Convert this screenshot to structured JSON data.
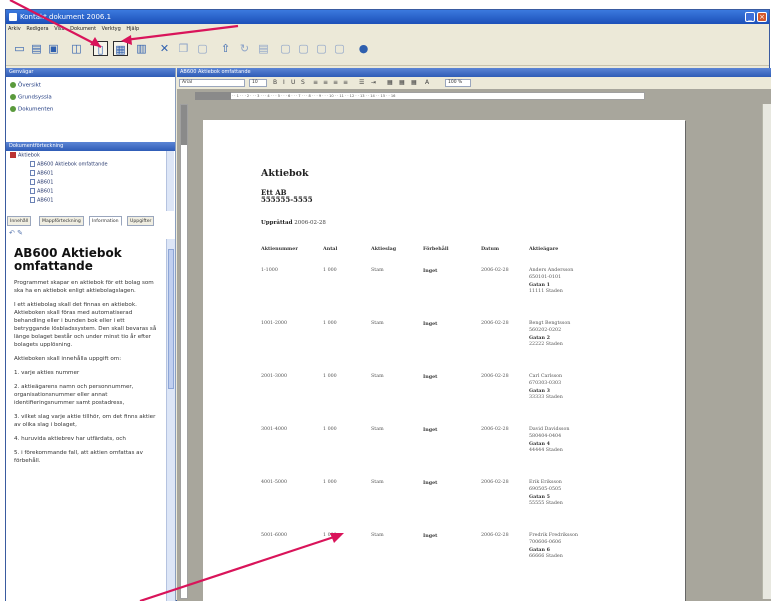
{
  "window": {
    "title": "Kontakt dokument 2006.1"
  },
  "menu": [
    "Arkiv",
    "Redigera",
    "Visa",
    "Dokument",
    "Verktyg",
    "Hjälp"
  ],
  "toolbar": {
    "icons": [
      "new-doc-icon",
      "open-icon",
      "save-icon",
      "print-preview-icon",
      "copy-doc-icon",
      "layout-icon",
      "columns-icon",
      "cut-icon",
      "copy-icon",
      "paste-icon",
      "upload-icon",
      "refresh-icon",
      "document-icon",
      "frame-icon",
      "frame-icon",
      "frame-icon",
      "frame-icon",
      "help-icon"
    ]
  },
  "left": {
    "header1": "Genvägar",
    "links": [
      "Översikt",
      "Grundsyssla",
      "Dokumenten"
    ],
    "header2": "Dokumentförteckning",
    "tree": {
      "root": "Aktiebok",
      "items": [
        "AB600 Aktiebok omfattande",
        "AB601",
        "AB601",
        "AB601",
        "AB601"
      ]
    },
    "tabs": [
      "Innehåll",
      "Mappförteckning",
      "Information",
      "Uppgifter"
    ],
    "info_title": "AB600 Aktiebok omfattande",
    "info_paragraphs": [
      "Programmet skapar en aktiebok för ett bolag som ska ha en aktiebok enligt aktiebolagslagen.",
      "I ett aktiebolag skall det finnas en aktiebok. Aktieboken skall föras med automatiserad behandling eller i bunden bok eller i ett betryggande lösbladssystem. Den skall bevaras så länge bolaget består och under minst tio år efter bolagets upplösning.",
      "Aktieboken skall innehålla uppgift om:",
      "1. varje akties nummer",
      "2. aktieägarens namn och personnummer, organisationsnummer eller annat identifieringsnummer samt postadress,",
      "3. vilket slag varje aktie tillhör, om det finns aktier av olika slag i bolaget,",
      "4. huruvida aktiebrev har utfärdats, och",
      "5. i förekommande fall, att aktien omfattas av förbehåll."
    ]
  },
  "right": {
    "panel_title": "AB600 Aktiebok omfattande",
    "font_field": "Arial",
    "size_field": "10",
    "zoom_field": "100 %",
    "ruler_marks": "· · 1 · · · 2 · · · 3 · · · 4 · · · 5 · · · 6 · · · 7 · · · 8 · · · 9 · · · 10 · · 11 · · 12 · · 13 · · 14 · · 15 · · 16"
  },
  "document": {
    "title": "Aktiebok",
    "company": "Ett AB",
    "orgnr": "555555-5555",
    "date_label": "Upprättad",
    "date_value": "2006-02-28",
    "columns": [
      "Aktienummer",
      "Antal",
      "Aktieslag",
      "Förbehåll",
      "Datum",
      "Aktieägare"
    ],
    "rows": [
      {
        "nummer": "1-1000",
        "antal": "1 000",
        "slag": "Stam",
        "forbehall": "Inget",
        "datum": "2006-02-28",
        "agare": [
          "Anders Andersson",
          "650101-0101",
          "Gatan 1",
          "11111 Staden"
        ]
      },
      {
        "nummer": "1001-2000",
        "antal": "1 000",
        "slag": "Stam",
        "forbehall": "Inget",
        "datum": "2006-02-28",
        "agare": [
          "Bengt Bengtsson",
          "560202-0202",
          "Gatan 2",
          "22222 Staden"
        ]
      },
      {
        "nummer": "2001-3000",
        "antal": "1 000",
        "slag": "Stam",
        "forbehall": "Inget",
        "datum": "2006-02-28",
        "agare": [
          "Carl Carlsson",
          "670303-0303",
          "Gatan 3",
          "33333 Staden"
        ]
      },
      {
        "nummer": "3001-4000",
        "antal": "1 000",
        "slag": "Stam",
        "forbehall": "Inget",
        "datum": "2006-02-28",
        "agare": [
          "David Davidsson",
          "580404-0404",
          "Gatan 4",
          "44444 Staden"
        ]
      },
      {
        "nummer": "4001-5000",
        "antal": "1 000",
        "slag": "Stam",
        "forbehall": "Inget",
        "datum": "2006-02-28",
        "agare": [
          "Erik Eriksson",
          "690505-0505",
          "Gatan 5",
          "55555 Staden"
        ]
      },
      {
        "nummer": "5001-6000",
        "antal": "1 000",
        "slag": "Stam",
        "forbehall": "Inget",
        "datum": "2006-02-28",
        "agare": [
          "Fredrik Fredriksson",
          "700606-0606",
          "Gatan 6",
          "66666 Staden"
        ]
      }
    ]
  },
  "annotation": {
    "arrow_color": "#d9145a"
  }
}
